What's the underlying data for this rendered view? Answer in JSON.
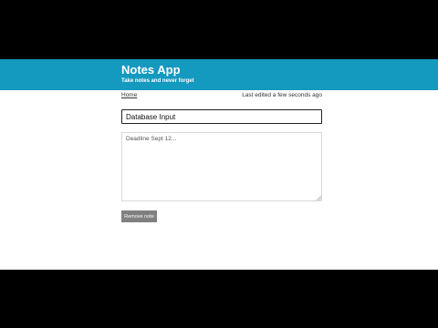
{
  "header": {
    "title": "Notes App",
    "subtitle": "Take notes and never forget"
  },
  "nav": {
    "home_label": "Home",
    "last_edited": "Last edited a few seconds ago"
  },
  "note": {
    "title_value": "Database Input",
    "body_value": "Deadline Sept 12..."
  },
  "actions": {
    "remove_label": "Remove note"
  },
  "colors": {
    "header_bg": "#1499bf",
    "remove_button_bg": "#808080",
    "letterbox": "#000000"
  }
}
